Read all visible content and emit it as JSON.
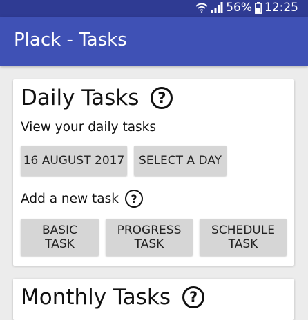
{
  "status_bar": {
    "battery": "56%",
    "time": "12:25",
    "icons": [
      "wifi-icon",
      "signal-icon",
      "battery-icon"
    ]
  },
  "app_bar": {
    "title": "Plack - Tasks"
  },
  "daily_card": {
    "title": "Daily Tasks",
    "help_icon": "?",
    "view_label": "View your daily tasks",
    "date_button": "16 AUGUST 2017",
    "select_day_button": "SELECT A DAY",
    "add_label": "Add a new task",
    "add_help_icon": "?",
    "task_buttons": [
      {
        "line1": "BASIC",
        "line2": "TASK"
      },
      {
        "line1": "PROGRESS",
        "line2": "TASK"
      },
      {
        "line1": "SCHEDULE",
        "line2": "TASK"
      }
    ]
  },
  "monthly_card": {
    "title": "Monthly Tasks",
    "help_icon": "?"
  },
  "colors": {
    "primary": "#3f51b5",
    "primary_dark": "#2f3b93",
    "button": "#d6d6d6",
    "background": "#ececec"
  }
}
